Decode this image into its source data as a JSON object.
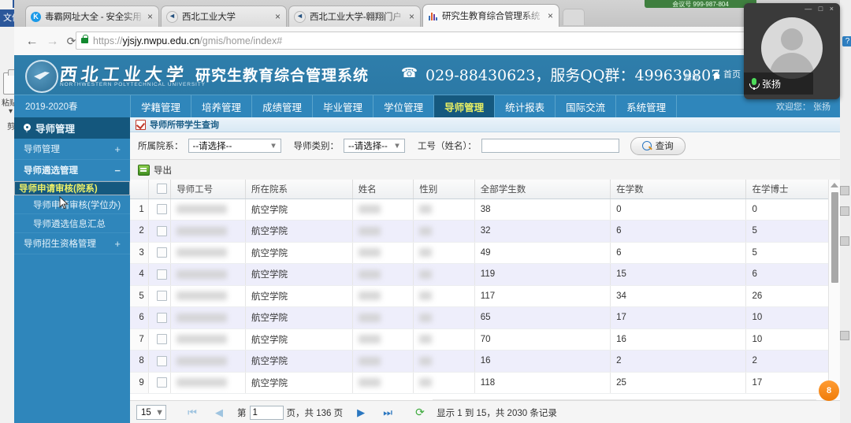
{
  "desktop": {
    "background_app": {
      "file_tab": "文件",
      "paste_label": "粘贴",
      "clipboard_label": "剪"
    },
    "help_button": "?",
    "qq_tip": "会议号 999-987-804",
    "badge": "8"
  },
  "browser": {
    "tabs": [
      {
        "title": "毒霸网址大全 - 安全实用",
        "favicon": "kingsoft-icon",
        "active": false,
        "close": "×"
      },
      {
        "title": "西北工业大学",
        "favicon": "nwpu-icon",
        "active": false,
        "close": "×"
      },
      {
        "title": "西北工业大学-翱翔门户",
        "favicon": "nwpu-icon",
        "active": false,
        "close": "×"
      },
      {
        "title": "研究生教育综合管理系统",
        "favicon": "chart-icon",
        "active": true,
        "close": "×"
      }
    ],
    "nav": {
      "back": "←",
      "forward": "→",
      "reload": "⟳",
      "url_prefix": "https://",
      "url_domain": "yjsjy.nwpu.edu.cn",
      "url_path": "/gmis/home/index#",
      "lock_icon": "lock-icon"
    }
  },
  "site": {
    "logo_cn": "西北工业大学",
    "logo_en": "NORTHWESTERN POLYTECHNICAL UNIVERSITY",
    "system_title": "研究生教育综合管理系统",
    "phone_icon": "☎",
    "contact": "029-88430623，服务QQ群：499639807",
    "help_link": "帮助",
    "home_link": "首页",
    "welcome": "欢迎您： 张扬"
  },
  "menubar": {
    "term": "2019-2020春",
    "items": [
      {
        "label": "学籍管理",
        "active": false
      },
      {
        "label": "培养管理",
        "active": false
      },
      {
        "label": "成绩管理",
        "active": false
      },
      {
        "label": "毕业管理",
        "active": false
      },
      {
        "label": "学位管理",
        "active": false
      },
      {
        "label": "导师管理",
        "active": true
      },
      {
        "label": "统计报表",
        "active": false
      },
      {
        "label": "国际交流",
        "active": false
      },
      {
        "label": "系统管理",
        "active": false
      }
    ]
  },
  "sidebar": {
    "title": "导师管理",
    "groups": [
      {
        "label": "导师管理",
        "expander": "+",
        "open": false
      },
      {
        "label": "导师遴选管理",
        "expander": "−",
        "open": true
      },
      {
        "label": "导师招生资格管理",
        "expander": "+",
        "open": false
      }
    ],
    "sub_items": [
      {
        "label": "导师申请审核(院系)",
        "selected": true
      },
      {
        "label": "导师申请审核(学位办)",
        "selected": false
      },
      {
        "label": "导师遴选信息汇总",
        "selected": false
      }
    ]
  },
  "panel": {
    "title": "导师所带学生查询",
    "filters": {
      "dept_label": "所属院系：",
      "dept_value": "--请选择--",
      "type_label": "导师类别：",
      "type_value": "--请选择--",
      "id_label": "工号（姓名）：",
      "id_value": "",
      "id_placeholder": "",
      "search_button": "查询"
    },
    "toolbar": {
      "export_label": "导出",
      "export_icon": "export-excel-icon"
    }
  },
  "grid": {
    "columns": [
      "",
      "",
      "导师工号",
      "所在院系",
      "姓名",
      "性别",
      "全部学生数",
      "在学数",
      "在学博士"
    ],
    "rows": [
      {
        "no": "1",
        "dept": "航空学院",
        "all_students": "38",
        "enrolled": "0",
        "phd": "0"
      },
      {
        "no": "2",
        "dept": "航空学院",
        "all_students": "32",
        "enrolled": "6",
        "phd": "5"
      },
      {
        "no": "3",
        "dept": "航空学院",
        "all_students": "49",
        "enrolled": "6",
        "phd": "5"
      },
      {
        "no": "4",
        "dept": "航空学院",
        "all_students": "119",
        "enrolled": "15",
        "phd": "6"
      },
      {
        "no": "5",
        "dept": "航空学院",
        "all_students": "117",
        "enrolled": "34",
        "phd": "26"
      },
      {
        "no": "6",
        "dept": "航空学院",
        "all_students": "65",
        "enrolled": "17",
        "phd": "10"
      },
      {
        "no": "7",
        "dept": "航空学院",
        "all_students": "70",
        "enrolled": "16",
        "phd": "10"
      },
      {
        "no": "8",
        "dept": "航空学院",
        "all_students": "16",
        "enrolled": "2",
        "phd": "2"
      },
      {
        "no": "9",
        "dept": "航空学院",
        "all_students": "118",
        "enrolled": "25",
        "phd": "17"
      }
    ]
  },
  "pager": {
    "page_size": "15",
    "first": "⏮",
    "prev": "◀",
    "next": "▶",
    "last": "⏭",
    "page_prefix": "第",
    "page_value": "1",
    "page_suffix": "页，共 136 页",
    "refresh_icon": "refresh-icon",
    "record_info": "显示 1 到 15，共 2030 条记录"
  },
  "webcam": {
    "name": "张扬",
    "mic_icon": "microphone-icon",
    "avatar": "avatar-placeholder",
    "window_buttons": "— □ ×"
  },
  "colors": {
    "brand_blue": "#2f86bb",
    "dark_blue": "#14577d",
    "accent_yellow": "#e9ef63",
    "link_blue": "#4652c9"
  }
}
